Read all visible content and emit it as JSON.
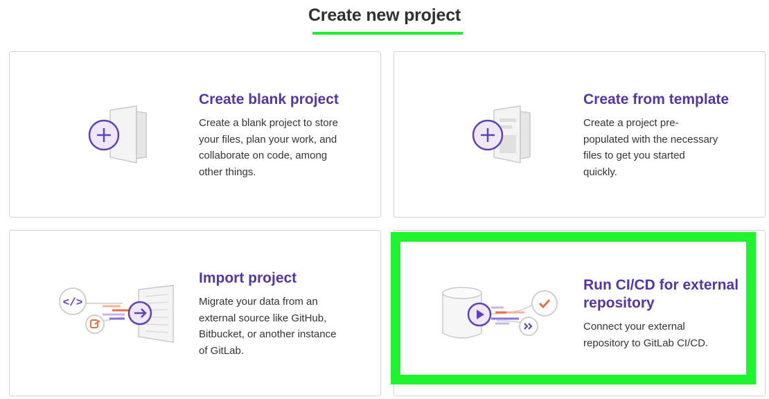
{
  "page": {
    "title": "Create new project"
  },
  "cards": [
    {
      "title": "Create blank project",
      "description": [
        "Create a blank project to store",
        "your files, plan your work, and",
        "collaborate on code, among",
        "other things."
      ]
    },
    {
      "title": "Create from template",
      "description": [
        "Create a project pre-",
        "populated with the necessary",
        "files to get you started",
        "quickly."
      ]
    },
    {
      "title": "Import project",
      "description": [
        "Migrate your data from an",
        "external source like GitHub,",
        "Bitbucket, or another instance",
        "of GitLab."
      ]
    },
    {
      "title": [
        "Run CI/CD for external",
        "repository"
      ],
      "description": [
        "Connect your external",
        "repository to GitLab CI/CD."
      ]
    }
  ],
  "colors": {
    "accent": "#5236a8",
    "highlight": "#1ef52f",
    "orange": "#e9703d"
  },
  "icons": [
    "plus-icon",
    "code-icon",
    "arrow-right-icon",
    "play-icon",
    "check-icon",
    "double-chevron-icon",
    "merge-request-icon"
  ]
}
